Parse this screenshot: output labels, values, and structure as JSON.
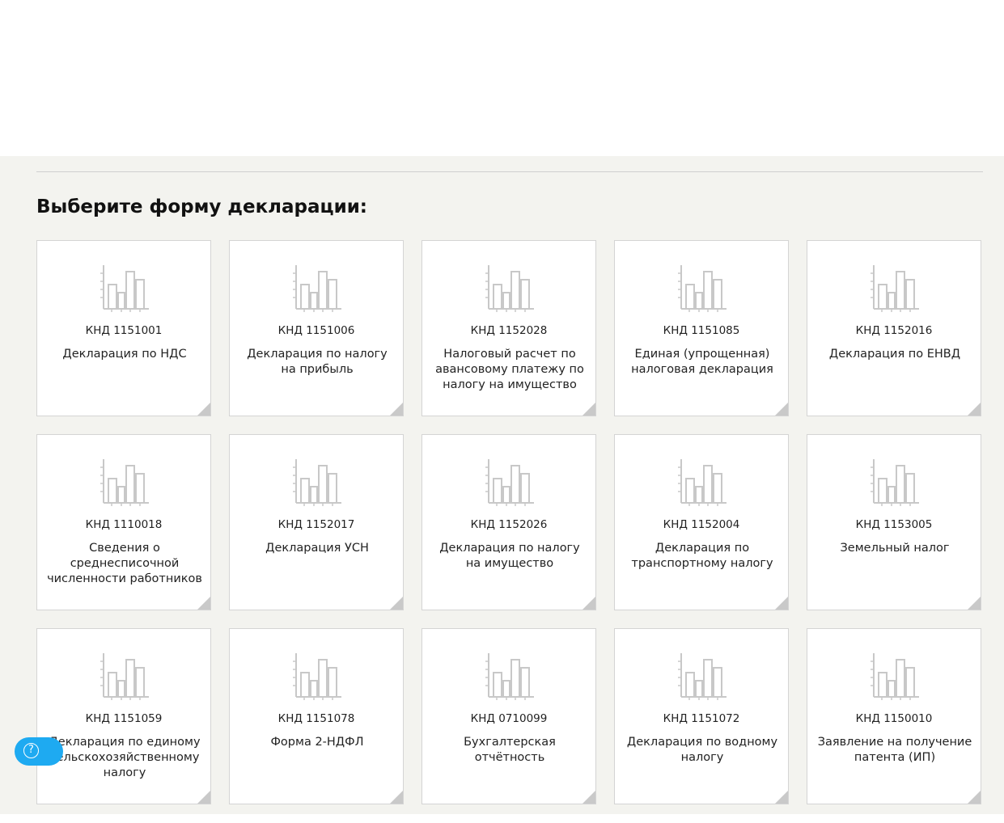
{
  "page": {
    "heading": "Выберите форму декларации:"
  },
  "colors": {
    "section_bg": "#f3f3ef",
    "card_bg": "#ffffff",
    "icon": "#c8c8c8",
    "help_button": "#1eaaf1"
  },
  "help_button": {
    "icon": "question-icon",
    "glyph": "?"
  },
  "cards": [
    {
      "code": "КНД 1151001",
      "title": "Декларация по НДС",
      "icon": "bar-chart-icon"
    },
    {
      "code": "КНД 1151006",
      "title": "Декларация по налогу на прибыль",
      "icon": "bar-chart-icon"
    },
    {
      "code": "КНД 1152028",
      "title": "Налоговый расчет по авансовому платежу по налогу на имущество",
      "icon": "bar-chart-icon"
    },
    {
      "code": "КНД 1151085",
      "title": "Единая (упрощенная) налоговая декларация",
      "icon": "bar-chart-icon"
    },
    {
      "code": "КНД 1152016",
      "title": "Декларация по ЕНВД",
      "icon": "bar-chart-icon"
    },
    {
      "code": "КНД 1110018",
      "title": "Сведения о среднесписочной численности работников",
      "icon": "bar-chart-icon"
    },
    {
      "code": "КНД 1152017",
      "title": "Декларация УСН",
      "icon": "bar-chart-icon"
    },
    {
      "code": "КНД 1152026",
      "title": "Декларация по налогу на имущество",
      "icon": "bar-chart-icon"
    },
    {
      "code": "КНД 1152004",
      "title": "Декларация по транспортному налогу",
      "icon": "bar-chart-icon"
    },
    {
      "code": "КНД 1153005",
      "title": "Земельный налог",
      "icon": "bar-chart-icon"
    },
    {
      "code": "КНД 1151059",
      "title": "Декларация по единому сельскохозяйственному налогу",
      "icon": "bar-chart-icon"
    },
    {
      "code": "КНД 1151078",
      "title": "Форма 2-НДФЛ",
      "icon": "bar-chart-icon"
    },
    {
      "code": "КНД 0710099",
      "title": "Бухгалтерская отчётность",
      "icon": "bar-chart-icon"
    },
    {
      "code": "КНД 1151072",
      "title": "Декларация по водному налогу",
      "icon": "bar-chart-icon"
    },
    {
      "code": "КНД 1150010",
      "title": "Заявление на получение патента (ИП)",
      "icon": "bar-chart-icon"
    }
  ]
}
